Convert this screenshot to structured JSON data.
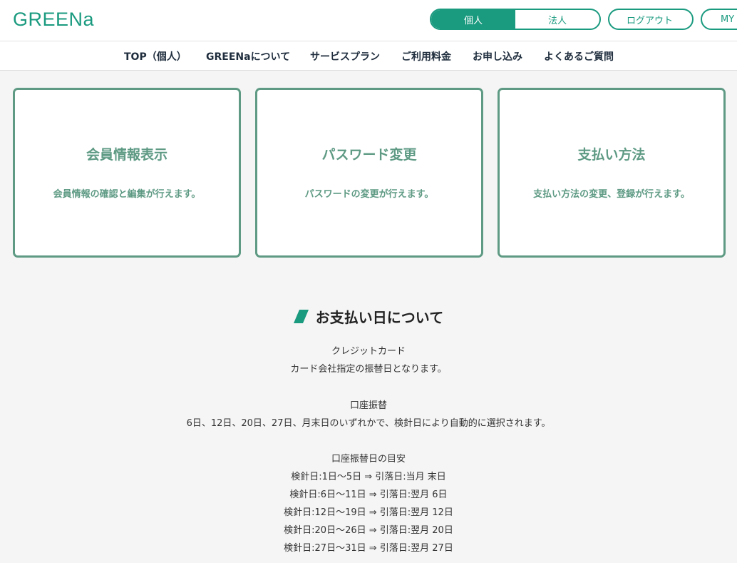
{
  "header": {
    "logo_text": "GREENa",
    "toggle": {
      "personal_label": "個人",
      "corporate_label": "法人"
    },
    "logout_label": "ログアウト",
    "mypage_label": "MY"
  },
  "nav": {
    "items": [
      "TOP（個人）",
      "GREENaについて",
      "サービスプラン",
      "ご利用料金",
      "お申し込み",
      "よくあるご質問"
    ]
  },
  "cards": [
    {
      "title": "会員情報表示",
      "desc": "会員情報の確認と編集が行えます。"
    },
    {
      "title": "パスワード変更",
      "desc": "パスワードの変更が行えます。"
    },
    {
      "title": "支払い方法",
      "desc": "支払い方法の変更、登録が行えます。"
    }
  ],
  "payment": {
    "title": "お支払い日について",
    "credit_heading": "クレジットカード",
    "credit_text": "カード会社指定の振替日となります。",
    "bank_heading": "口座振替",
    "bank_text": "6日、12日、20日、27日、月末日のいずれかで、検針日により自動的に選択されます。",
    "guide_heading": "口座振替日の目安",
    "guide_rows": [
      "検針日:1日～5日 ⇒ 引落日:当月 末日",
      "検針日:6日～11日 ⇒ 引落日:翌月 6日",
      "検針日:12日～19日 ⇒ 引落日:翌月 12日",
      "検針日:20日～26日 ⇒ 引落日:翌月 20日",
      "検針日:27日～31日 ⇒ 引落日:翌月 27日"
    ]
  },
  "colors": {
    "brand": "#1a9a7f",
    "card_accent": "#5e9a84",
    "background": "#f5f5f5"
  }
}
